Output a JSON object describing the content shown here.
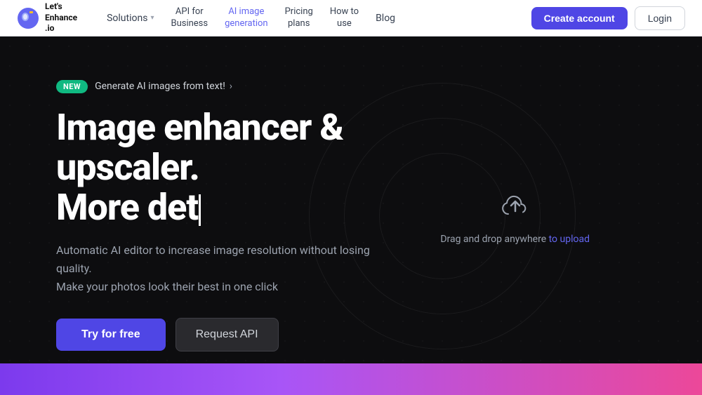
{
  "navbar": {
    "logo_text": "Let's\nEnhance\n.io",
    "nav_items": [
      {
        "id": "solutions",
        "label": "Solutions",
        "has_chevron": true,
        "active": false
      },
      {
        "id": "api",
        "label": "API for Business",
        "has_chevron": false,
        "active": false
      },
      {
        "id": "ai-image",
        "label": "AI image generation",
        "has_chevron": false,
        "active": true
      },
      {
        "id": "pricing",
        "label": "Pricing plans",
        "has_chevron": false,
        "active": false
      },
      {
        "id": "how-to-use",
        "label": "How to use",
        "has_chevron": false,
        "active": false
      },
      {
        "id": "blog",
        "label": "Blog",
        "has_chevron": false,
        "active": false
      }
    ],
    "create_account": "Create account",
    "login": "Login"
  },
  "hero": {
    "badge": "NEW",
    "badge_text": "Generate AI images from text!",
    "title_line1": "Image enhancer & upscaler.",
    "title_line2": "More det",
    "subtitle_line1": "Automatic AI editor to increase image resolution without losing quality.",
    "subtitle_line2": "Make your photos look their best in one click",
    "try_button": "Try for free",
    "api_button": "Request API",
    "upload_text": "Drag and drop anywhere",
    "upload_link": "to upload"
  }
}
